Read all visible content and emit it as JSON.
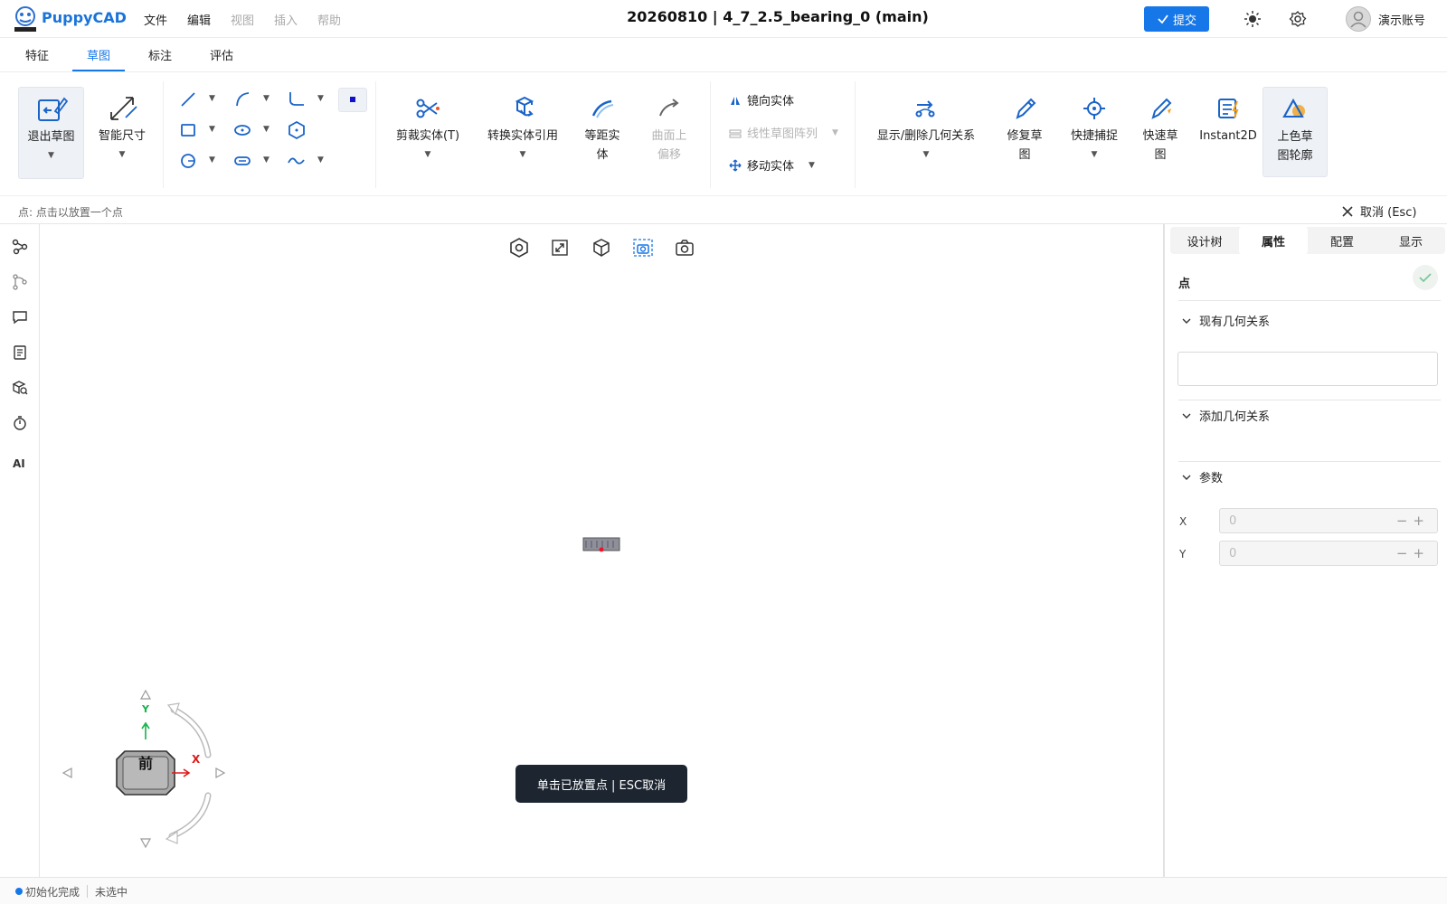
{
  "app": {
    "brand": "PuppyCAD",
    "menu": [
      "文件",
      "编辑",
      "视图",
      "插入",
      "帮助"
    ],
    "doc_title": "20260810 | 4_7_2.5_bearing_0 (main)",
    "submit_label": "提交",
    "account_name": "演示账号"
  },
  "tabs": [
    "特征",
    "草图",
    "标注",
    "评估"
  ],
  "active_tab": "草图",
  "ribbon": {
    "exit_sketch": "退出草图",
    "smart_dimension": "智能尺寸",
    "trim": "剪裁实体(T)",
    "convert": "转换实体引用",
    "offset_a": "等距实",
    "offset_b": "体",
    "surface_offset_a": "曲面上",
    "surface_offset_b": "偏移",
    "mirror": "镜向实体",
    "linear_pattern": "线性草图阵列",
    "move": "移动实体",
    "relations": "显示/删除几何关系",
    "repair_a": "修复草",
    "repair_b": "图",
    "quick_snap": "快捷捕捉",
    "quick_sketch_a": "快速草",
    "quick_sketch_b": "图",
    "instant2d": "Instant2D",
    "shade_a": "上色草",
    "shade_b": "图轮廓"
  },
  "hint_bar": {
    "hint": "点: 点击以放置一个点",
    "cancel": "取消 (Esc)"
  },
  "left_rail": {
    "ai_label": "AI"
  },
  "viewport": {
    "toast": "单击已放置点 | ESC取消",
    "view_cube": {
      "face": "前",
      "x_label": "X",
      "y_label": "Y"
    }
  },
  "right_panel": {
    "tabs": [
      "设计树",
      "属性",
      "配置",
      "显示"
    ],
    "active_tab": "属性",
    "entity": "点",
    "sections": [
      "现有几何关系",
      "添加几何关系",
      "参数"
    ],
    "params": [
      {
        "label": "X",
        "value": "0"
      },
      {
        "label": "Y",
        "value": "0"
      }
    ]
  },
  "status_bar": {
    "state": "初始化完成",
    "selection": "未选中"
  },
  "colors": {
    "accent": "#1677e8",
    "toast_bg": "#1d2530",
    "axis_x": "#e84a2e",
    "axis_y": "#4ad12e"
  },
  "icons": [
    "logo-icon",
    "check-icon",
    "sun-icon",
    "gear-icon",
    "user-icon",
    "close-icon"
  ]
}
